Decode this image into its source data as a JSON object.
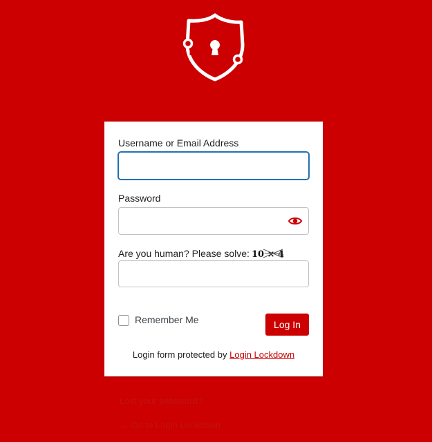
{
  "logo": {
    "icon": "shield-lock-icon",
    "color": "#ffffff"
  },
  "colors": {
    "background": "#cc0000",
    "accent": "#cc0000",
    "focus": "#2271b1"
  },
  "form": {
    "username_label": "Username or Email Address",
    "username_value": "",
    "password_label": "Password",
    "password_value": "",
    "password_toggle_icon": "eye-icon",
    "captcha_label": "Are you human? Please solve:",
    "captcha_image_text": "10 × 4",
    "captcha_value": "",
    "remember_label": "Remember Me",
    "remember_checked": false,
    "submit_label": "Log In",
    "protected_prefix": "Login form protected by",
    "protected_link": "Login Lockdown"
  },
  "links": {
    "lost_password": "Lost your password?",
    "back_to": "← Go to Login Lockdown"
  }
}
